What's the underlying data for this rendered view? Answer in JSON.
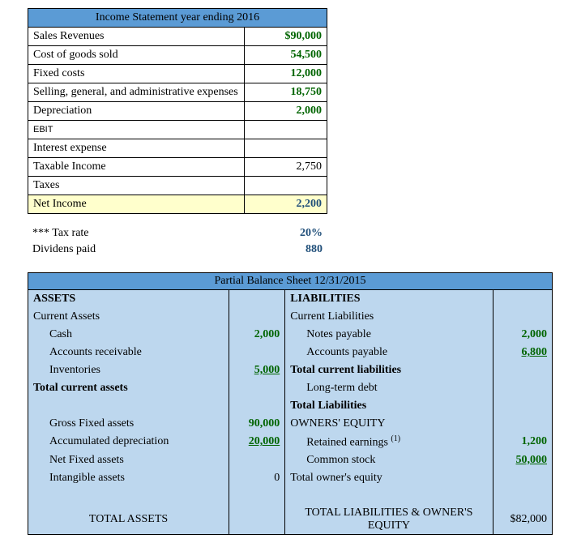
{
  "income": {
    "title": "Income Statement year ending 2016",
    "rows": {
      "sales_label": "Sales Revenues",
      "sales_value": "$90,000",
      "cogs_label": "Cost of goods sold",
      "cogs_value": "54,500",
      "fixed_label": "Fixed costs",
      "fixed_value": "12,000",
      "sga_label": "Selling, general, and administrative expenses",
      "sga_value": "18,750",
      "dep_label": "Depreciation",
      "dep_value": "2,000",
      "ebit_label": "EBIT",
      "ebit_value": "",
      "int_label": "Interest expense",
      "int_value": "",
      "taxable_label": "Taxable Income",
      "taxable_value": "2,750",
      "tax_label": "Taxes",
      "tax_value": "",
      "net_label": "Net Income",
      "net_value": "2,200"
    }
  },
  "notes": {
    "taxrate_label": "*** Tax rate",
    "taxrate_value": "20%",
    "div_label": "Dividens paid",
    "div_value": "880"
  },
  "bs": {
    "title": "Partial Balance Sheet 12/31/2015",
    "left": {
      "assets": "ASSETS",
      "current_assets": "Current Assets",
      "cash": "Cash",
      "cash_v": "2,000",
      "ar": "Accounts receivable",
      "ar_v": "",
      "inv": "Inventories",
      "inv_v": "5,000",
      "tca": "Total current assets",
      "tca_v": "",
      "gfa": "Gross Fixed assets",
      "gfa_v": "90,000",
      "ad": "Accumulated depreciation",
      "ad_v": "20,000",
      "nfa": "Net Fixed assets",
      "nfa_v": "",
      "ia": "Intangible assets",
      "ia_v": "0",
      "total": "TOTAL ASSETS",
      "total_v": ""
    },
    "right": {
      "liab": "LIABILITIES",
      "cl": "Current Liabilities",
      "np": "Notes payable",
      "np_v": "2,000",
      "ap": "Accounts payable",
      "ap_v": "6,800",
      "tcl": "Total current liabilities",
      "tcl_v": "",
      "ltd": "Long-term debt",
      "ltd_v": "",
      "tl": "Total Liabilities",
      "tl_v": "",
      "oe": "OWNERS' EQUITY",
      "re": "Retained earnings ",
      "re_sup": "(1)",
      "re_v": "1,200",
      "cs": "Common stock",
      "cs_v": "50,000",
      "toe": "Total owner's equity",
      "toe_v": "",
      "total": "TOTAL LIABILITIES & OWNER'S EQUITY",
      "total_v": "$82,000"
    }
  },
  "chart_data": {
    "type": "table",
    "income_statement_2016": {
      "Sales Revenues": 90000,
      "Cost of goods sold": 54500,
      "Fixed costs": 12000,
      "Selling, general, and administrative expenses": 18750,
      "Depreciation": 2000,
      "EBIT": null,
      "Interest expense": null,
      "Taxable Income": 2750,
      "Taxes": null,
      "Net Income": 2200
    },
    "tax_rate": 0.2,
    "dividends_paid": 880,
    "balance_sheet_2015_12_31": {
      "assets": {
        "Cash": 2000,
        "Accounts receivable": null,
        "Inventories": 5000,
        "Total current assets": null,
        "Gross Fixed assets": 90000,
        "Accumulated depreciation": 20000,
        "Net Fixed assets": null,
        "Intangible assets": 0,
        "TOTAL ASSETS": null
      },
      "liabilities_equity": {
        "Notes payable": 2000,
        "Accounts payable": 6800,
        "Total current liabilities": null,
        "Long-term debt": null,
        "Total Liabilities": null,
        "Retained earnings": 1200,
        "Common stock": 50000,
        "Total owner's equity": null,
        "TOTAL LIABILITIES & OWNER'S EQUITY": 82000
      }
    }
  }
}
